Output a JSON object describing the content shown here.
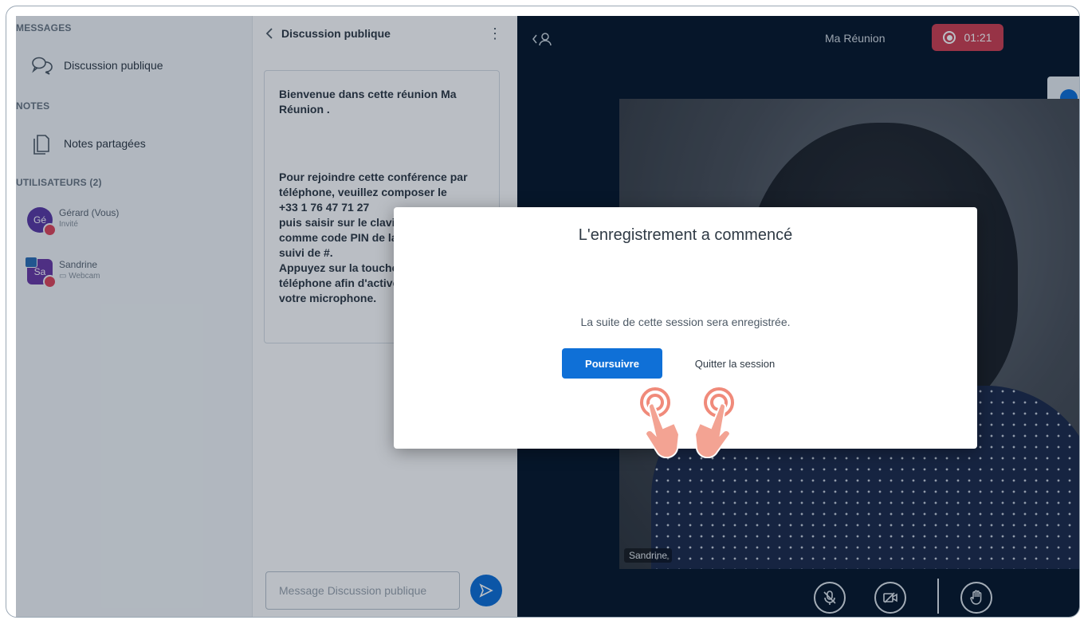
{
  "sidebar": {
    "messages_title": "MESSAGES",
    "public_chat_label": "Discussion publique",
    "notes_title": "NOTES",
    "shared_notes_label": "Notes partagées",
    "users_title": "UTILISATEURS (2)",
    "users": [
      {
        "initials": "Gé",
        "name": "Gérard (Vous)",
        "sub": "Invité",
        "color": "#5b3aa6"
      },
      {
        "initials": "Sa",
        "name": "Sandrine",
        "sub": "▭ Webcam",
        "color": "#6a3aa6"
      }
    ]
  },
  "chat": {
    "header": "Discussion publique",
    "welcome_line1": "Bienvenue dans cette réunion ",
    "welcome_meeting": "Ma Réunion",
    "welcome_end": " .",
    "dial_text": "Pour rejoindre cette conférence par téléphone, veuillez composer le",
    "dial_number": "+33 1 76 47 71 27",
    "pin_text": "puis saisir sur le clavier",
    "pin_code": "comme code PIN de la conférence",
    "pin_suffix": "suivi de #.",
    "unmute_text": "Appuyez sur la touche",
    "unmute_text2": "téléphone afin d'activer",
    "unmute_text3": "votre microphone.",
    "input_placeholder": "Message Discussion publique"
  },
  "video": {
    "meeting_title": "Ma Réunion",
    "recording_time": "01:21",
    "participant_label": "Sandrine",
    "colors": {
      "background": "#06172a",
      "recording": "#cf3f51",
      "accent": "#0f70d7"
    }
  },
  "modal": {
    "title": "L'enregistrement a commencé",
    "description": "La suite de cette session sera enregistrée.",
    "continue_label": "Poursuivre",
    "leave_label": "Quitter la session"
  }
}
